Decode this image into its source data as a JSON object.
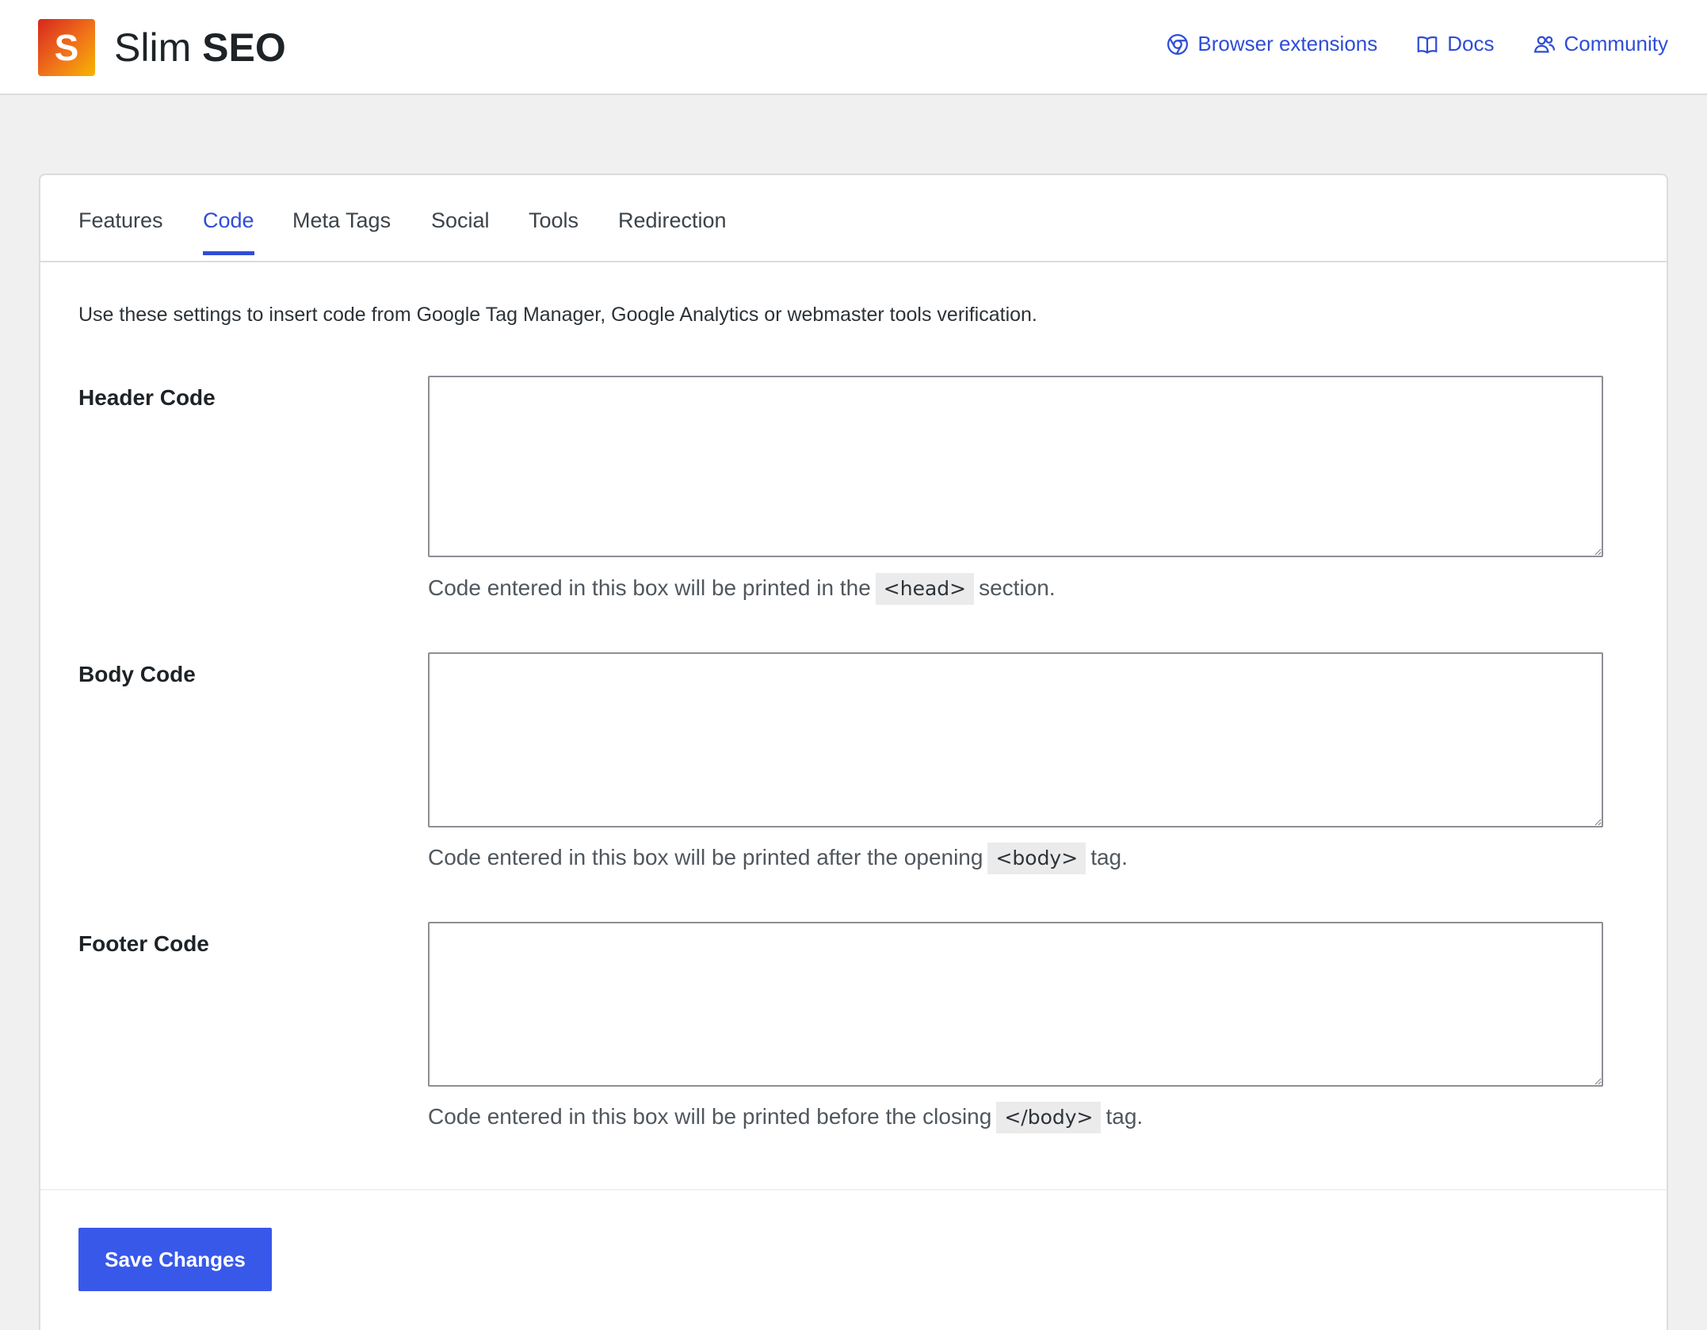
{
  "header": {
    "logo_letter": "S",
    "logo_text_light": "Slim",
    "logo_text_bold": "SEO",
    "links": [
      {
        "label": "Browser extensions",
        "icon": "chrome-icon"
      },
      {
        "label": "Docs",
        "icon": "book-icon"
      },
      {
        "label": "Community",
        "icon": "users-icon"
      }
    ]
  },
  "tabs": [
    {
      "label": "Features"
    },
    {
      "label": "Code",
      "active": true
    },
    {
      "label": "Meta Tags"
    },
    {
      "label": "Social"
    },
    {
      "label": "Tools"
    },
    {
      "label": "Redirection"
    }
  ],
  "intro": "Use these settings to insert code from Google Tag Manager, Google Analytics or webmaster tools verification.",
  "fields": {
    "header": {
      "label": "Header Code",
      "value": "",
      "hint_before": "Code entered in this box will be printed in the",
      "hint_code": "<head>",
      "hint_after": "section."
    },
    "body": {
      "label": "Body Code",
      "value": "",
      "hint_before": "Code entered in this box will be printed after the opening",
      "hint_code": "<body>",
      "hint_after": "tag."
    },
    "footer": {
      "label": "Footer Code",
      "value": "",
      "hint_before": "Code entered in this box will be printed before the closing",
      "hint_code": "</body>",
      "hint_after": "tag."
    }
  },
  "save_label": "Save Changes",
  "colors": {
    "accent": "#2f4dd6",
    "button": "#3858e9",
    "background": "#f0f0f1"
  }
}
